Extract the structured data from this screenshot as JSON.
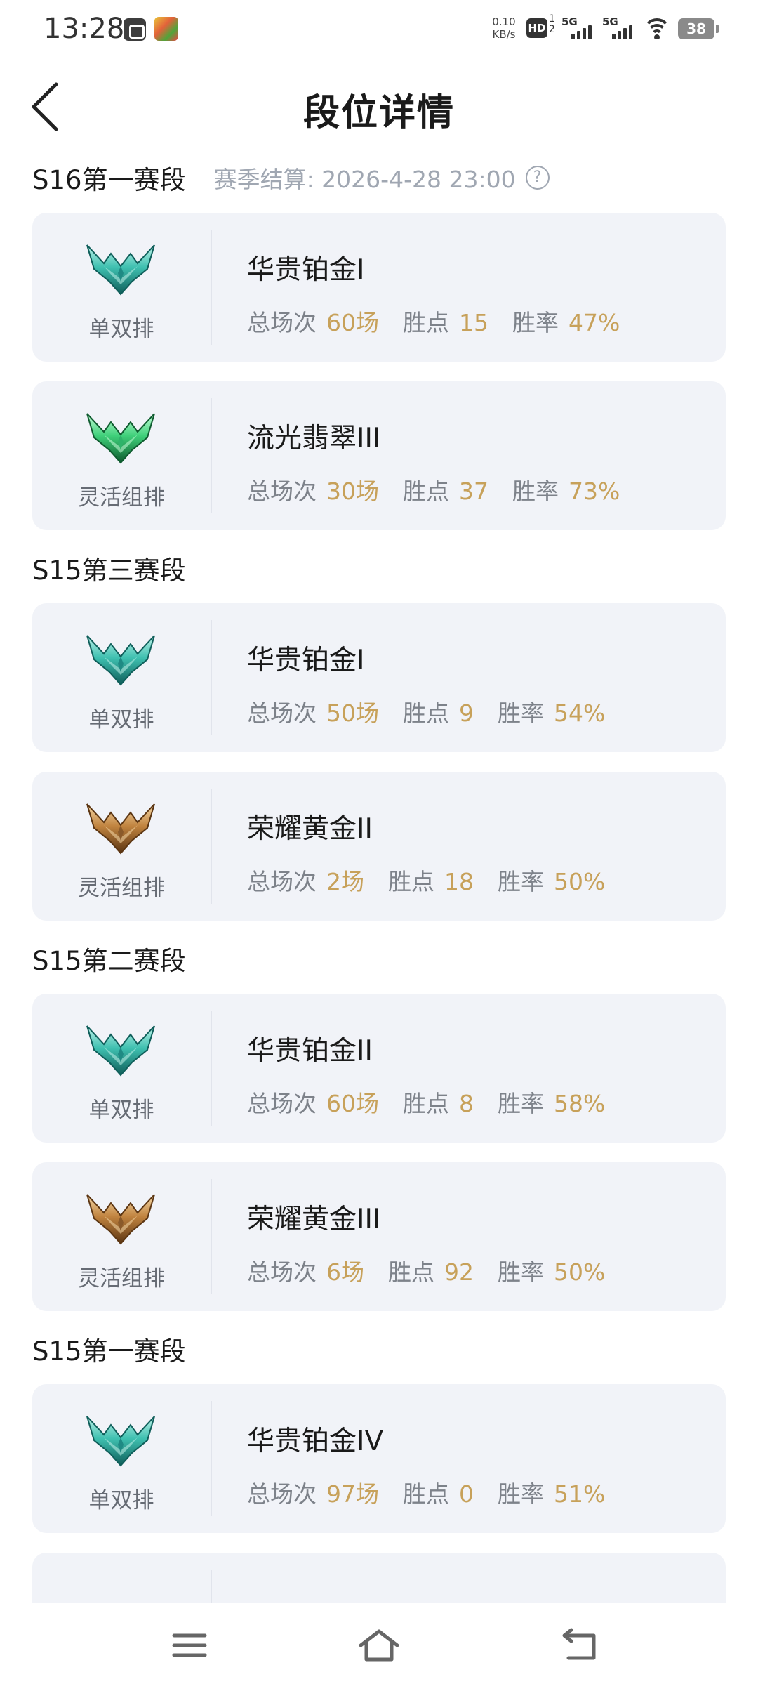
{
  "status_bar": {
    "time": "13:28",
    "net_speed_value": "0.10",
    "net_speed_unit": "KB/s",
    "hd_label": "HD",
    "hd_sub_top": "1",
    "hd_sub_bottom": "2",
    "sim1_label": "5G",
    "sim2_label": "5G",
    "battery_level": "38",
    "icons": [
      "app-notification-icon",
      "game-app-icon",
      "hd-voice-icon",
      "signal-icon",
      "wifi-icon",
      "battery-icon"
    ]
  },
  "header": {
    "title": "段位详情",
    "back_icon": "chevron-left-icon"
  },
  "stat_labels": {
    "games": "总场次",
    "points": "胜点",
    "win_rate": "胜率"
  },
  "seasons": [
    {
      "title": "S16第一赛段",
      "note": "赛季结算: 2026-4-28 23:00",
      "help_icon": "?",
      "ranks": [
        {
          "queue": "单双排",
          "rank": "华贵铂金I",
          "tier": "platinum",
          "games": "60场",
          "points": "15",
          "win_rate": "47%"
        },
        {
          "queue": "灵活组排",
          "rank": "流光翡翠III",
          "tier": "emerald",
          "games": "30场",
          "points": "37",
          "win_rate": "73%"
        }
      ]
    },
    {
      "title": "S15第三赛段",
      "ranks": [
        {
          "queue": "单双排",
          "rank": "华贵铂金I",
          "tier": "platinum",
          "games": "50场",
          "points": "9",
          "win_rate": "54%"
        },
        {
          "queue": "灵活组排",
          "rank": "荣耀黄金II",
          "tier": "gold",
          "games": "2场",
          "points": "18",
          "win_rate": "50%"
        }
      ]
    },
    {
      "title": "S15第二赛段",
      "ranks": [
        {
          "queue": "单双排",
          "rank": "华贵铂金II",
          "tier": "platinum",
          "games": "60场",
          "points": "8",
          "win_rate": "58%"
        },
        {
          "queue": "灵活组排",
          "rank": "荣耀黄金III",
          "tier": "gold",
          "games": "6场",
          "points": "92",
          "win_rate": "50%"
        }
      ]
    },
    {
      "title": "S15第一赛段",
      "ranks": [
        {
          "queue": "单双排",
          "rank": "华贵铂金IV",
          "tier": "platinum",
          "games": "97场",
          "points": "0",
          "win_rate": "51%"
        }
      ]
    }
  ],
  "nav_bar": {
    "items": [
      "menu-icon",
      "home-icon",
      "back-icon"
    ]
  },
  "colors": {
    "card_background": "#f1f3f8",
    "stat_value": "#c7a15a",
    "stat_label": "#7d828a",
    "note_text": "#a0a7b2",
    "platinum": "#1f8a84",
    "emerald": "#2fb36a",
    "gold": "#8a5a2a"
  }
}
